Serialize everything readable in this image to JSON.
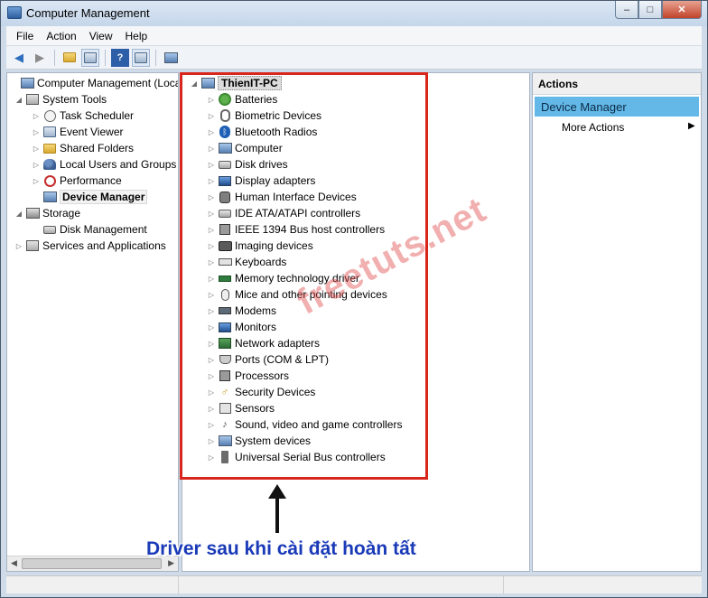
{
  "window": {
    "title": "Computer Management",
    "controls": [
      "–",
      "□",
      "✕"
    ]
  },
  "menu": [
    "File",
    "Action",
    "View",
    "Help"
  ],
  "left_tree": [
    {
      "label": "Computer Management (Local",
      "icon": "computer-management-icon",
      "arrow": "",
      "indent": 0
    },
    {
      "label": "System Tools",
      "icon": "tools-icon",
      "arrow": "◢",
      "indent": 1
    },
    {
      "label": "Task Scheduler",
      "icon": "clock-icon",
      "arrow": "▷",
      "indent": 2
    },
    {
      "label": "Event Viewer",
      "icon": "event-viewer-icon",
      "arrow": "▷",
      "indent": 2
    },
    {
      "label": "Shared Folders",
      "icon": "shared-folder-icon",
      "arrow": "▷",
      "indent": 2
    },
    {
      "label": "Local Users and Groups",
      "icon": "users-icon",
      "arrow": "▷",
      "indent": 2
    },
    {
      "label": "Performance",
      "icon": "performance-icon",
      "arrow": "▷",
      "indent": 2
    },
    {
      "label": "Device Manager",
      "icon": "device-manager-icon",
      "arrow": "",
      "indent": 2,
      "selected": true
    },
    {
      "label": "Storage",
      "icon": "storage-icon",
      "arrow": "◢",
      "indent": 1
    },
    {
      "label": "Disk Management",
      "icon": "disk-icon",
      "arrow": "",
      "indent": 2
    },
    {
      "label": "Services and Applications",
      "icon": "services-icon",
      "arrow": "▷",
      "indent": 1
    }
  ],
  "device_tree": {
    "root": "ThienIT-PC",
    "categories": [
      {
        "label": "Batteries",
        "icon": "battery-icon"
      },
      {
        "label": "Biometric Devices",
        "icon": "fingerprint-icon"
      },
      {
        "label": "Bluetooth Radios",
        "icon": "bluetooth-icon"
      },
      {
        "label": "Computer",
        "icon": "computer-icon"
      },
      {
        "label": "Disk drives",
        "icon": "disk-drive-icon"
      },
      {
        "label": "Display adapters",
        "icon": "display-adapter-icon"
      },
      {
        "label": "Human Interface Devices",
        "icon": "hid-icon"
      },
      {
        "label": "IDE ATA/ATAPI controllers",
        "icon": "ide-controller-icon"
      },
      {
        "label": "IEEE 1394 Bus host controllers",
        "icon": "ieee1394-icon"
      },
      {
        "label": "Imaging devices",
        "icon": "camera-icon"
      },
      {
        "label": "Keyboards",
        "icon": "keyboard-icon"
      },
      {
        "label": "Memory technology driver",
        "icon": "memory-icon"
      },
      {
        "label": "Mice and other pointing devices",
        "icon": "mouse-icon"
      },
      {
        "label": "Modems",
        "icon": "modem-icon"
      },
      {
        "label": "Monitors",
        "icon": "monitor-icon"
      },
      {
        "label": "Network adapters",
        "icon": "network-adapter-icon"
      },
      {
        "label": "Ports (COM & LPT)",
        "icon": "port-icon"
      },
      {
        "label": "Processors",
        "icon": "processor-icon"
      },
      {
        "label": "Security Devices",
        "icon": "key-icon"
      },
      {
        "label": "Sensors",
        "icon": "sensor-icon"
      },
      {
        "label": "Sound, video and game controllers",
        "icon": "sound-icon"
      },
      {
        "label": "System devices",
        "icon": "system-device-icon"
      },
      {
        "label": "Universal Serial Bus controllers",
        "icon": "usb-icon"
      }
    ]
  },
  "actions": {
    "header": "Actions",
    "section": "Device Manager",
    "more": "More Actions"
  },
  "annotation": {
    "caption": "Driver sau khi cài đặt hoàn tất",
    "watermark": "freetuts.net",
    "highlight_color": "#d9261c",
    "caption_color": "#1a3ab8"
  }
}
